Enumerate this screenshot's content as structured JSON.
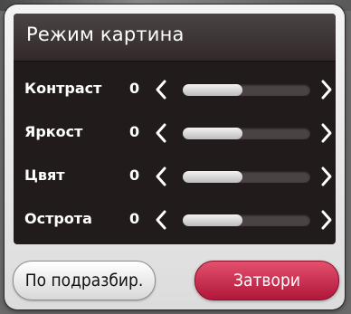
{
  "dialog": {
    "title": "Режим картина",
    "rows": [
      {
        "label": "Контраст",
        "value": "0",
        "level": 0.47
      },
      {
        "label": "Яркост",
        "value": "0",
        "level": 0.47
      },
      {
        "label": "Цвят",
        "value": "0",
        "level": 0.47
      },
      {
        "label": "Острота",
        "value": "0",
        "level": 0.47
      }
    ],
    "buttons": {
      "default_label": "По подразбир.",
      "close_label": "Затвори"
    }
  },
  "colors": {
    "accent": "#c8244a",
    "panel": "#221b1b"
  },
  "icons": [
    "chevron-left-icon",
    "chevron-right-icon"
  ]
}
